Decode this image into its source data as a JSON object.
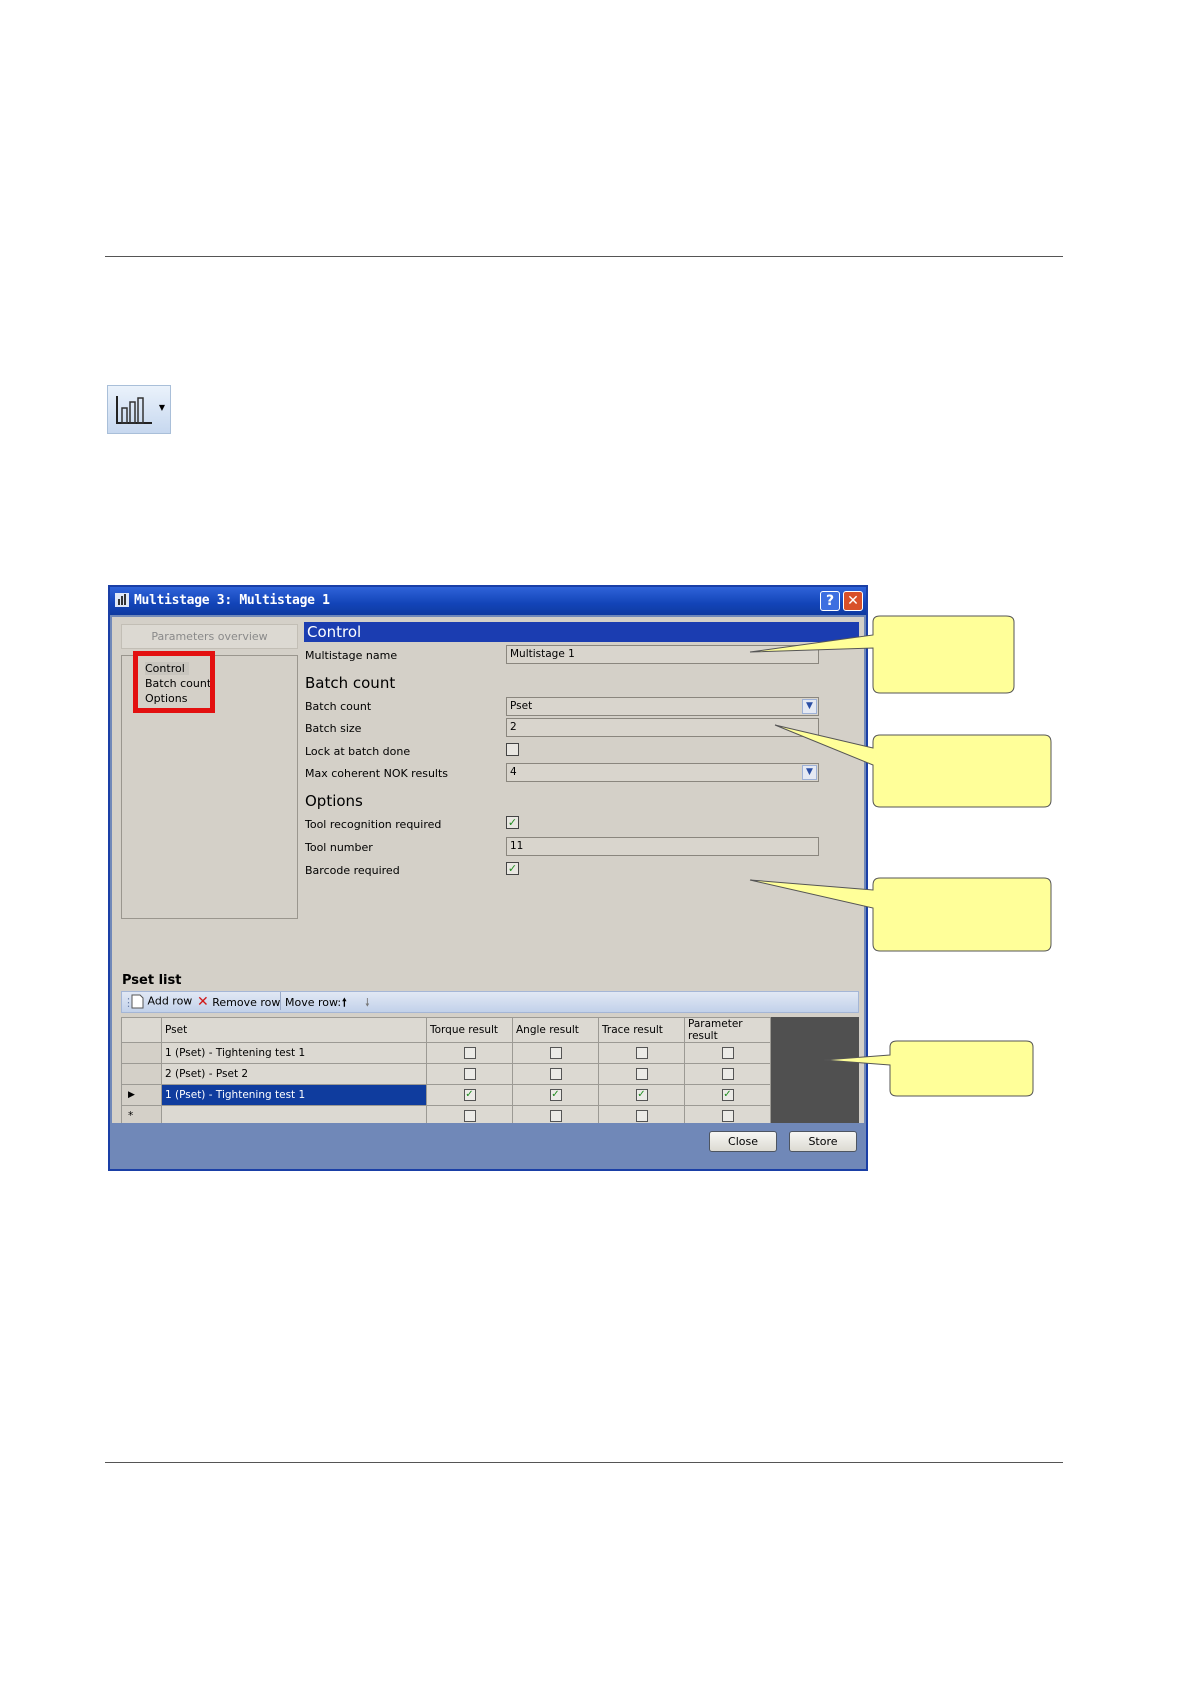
{
  "window": {
    "title": "Multistage 3: Multistage 1"
  },
  "nav": {
    "header": "Parameters overview",
    "items": [
      "Control",
      "Batch count",
      "Options"
    ]
  },
  "control": {
    "section_title": "Control",
    "multistage_name_label": "Multistage name",
    "multistage_name_value": "Multistage 1"
  },
  "batch": {
    "title": "Batch count",
    "batch_count_label": "Batch count",
    "batch_count_value": "Pset",
    "batch_size_label": "Batch size",
    "batch_size_value": "2",
    "lock_label": "Lock at batch done",
    "lock_checked": false,
    "max_nok_label": "Max coherent NOK results",
    "max_nok_value": "4"
  },
  "options": {
    "title": "Options",
    "tool_recognition_label": "Tool recognition required",
    "tool_recognition_checked": true,
    "tool_number_label": "Tool number",
    "tool_number_value": "11",
    "barcode_label": "Barcode required",
    "barcode_checked": true
  },
  "pset_list": {
    "title": "Pset list",
    "add_row": "Add row",
    "remove_row": "Remove row",
    "move_row": "Move row:",
    "headers": [
      "Pset",
      "Torque result",
      "Angle result",
      "Trace result",
      "Parameter result"
    ],
    "rows": [
      {
        "marker": "",
        "pset": "1 (Pset) - Tightening test 1",
        "checks": [
          false,
          false,
          false,
          false
        ]
      },
      {
        "marker": "",
        "pset": "2 (Pset) - Pset 2",
        "checks": [
          false,
          false,
          false,
          false
        ]
      },
      {
        "marker": "▶",
        "pset": "1 (Pset) - Tightening test 1",
        "checks": [
          true,
          true,
          true,
          true
        ]
      },
      {
        "marker": "*",
        "pset": "",
        "checks": [
          false,
          false,
          false,
          false
        ]
      }
    ]
  },
  "buttons": {
    "close": "Close",
    "store": "Store"
  },
  "colors": {
    "title_bar": "#1244b8",
    "section_header": "#1b3db1",
    "callout_fill": "#ffff99",
    "highlight_box": "#e31010"
  }
}
